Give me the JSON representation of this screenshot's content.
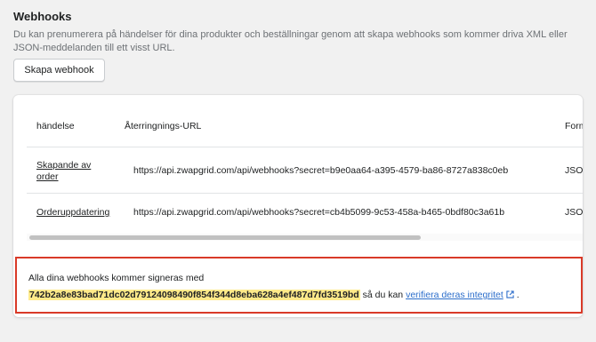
{
  "section": {
    "title": "Webhooks",
    "description": "Du kan prenumerera på händelser för dina produkter och beställningar genom att skapa webhooks som kommer driva XML eller JSON-meddelanden till ett visst URL.",
    "create_button": "Skapa webhook"
  },
  "table": {
    "headers": [
      "händelse",
      "Återringnings-URL",
      "Form"
    ],
    "rows": [
      {
        "event": "Skapande av order",
        "url": "https://api.zwapgrid.com/api/webhooks?secret=b9e0aa64-a395-4579-ba86-8727a838c0eb",
        "format": "JSON"
      },
      {
        "event": "Orderuppdatering",
        "url": "https://api.zwapgrid.com/api/webhooks?secret=cb4b5099-9c53-458a-b465-0bdf80c3a61b",
        "format": "JSON"
      }
    ]
  },
  "signature": {
    "intro": "Alla dina webhooks kommer signeras med",
    "key": "742b2a8e83bad71dc02d79124098490f854f344d8eba628a4ef487d7fd3519bd",
    "middle": "så du kan",
    "link": "verifiera deras integritet",
    "end": "."
  },
  "colors": {
    "highlight_border": "#d93a28",
    "key_highlight": "#ffea8a",
    "link": "#2c6ecb"
  }
}
